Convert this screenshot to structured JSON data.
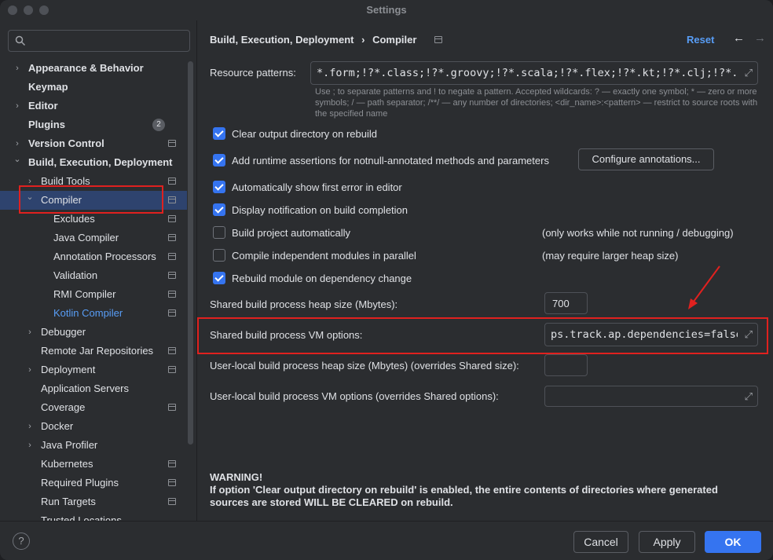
{
  "window": {
    "title": "Settings"
  },
  "search": {
    "placeholder": "",
    "value": ""
  },
  "sidebar": {
    "items": [
      {
        "label": "Appearance & Behavior",
        "level": 0,
        "expander": "collapsed",
        "bold": true
      },
      {
        "label": "Keymap",
        "level": 0,
        "expander": "none",
        "bold": true
      },
      {
        "label": "Editor",
        "level": 0,
        "expander": "collapsed",
        "bold": true
      },
      {
        "label": "Plugins",
        "level": 0,
        "expander": "none",
        "bold": true,
        "badge": "2"
      },
      {
        "label": "Version Control",
        "level": 0,
        "expander": "collapsed",
        "bold": true,
        "page_icon": true
      },
      {
        "label": "Build, Execution, Deployment",
        "level": 0,
        "expander": "expanded",
        "bold": true
      },
      {
        "label": "Build Tools",
        "level": 1,
        "expander": "collapsed",
        "page_icon": true
      },
      {
        "label": "Compiler",
        "level": 1,
        "expander": "expanded",
        "page_icon": true,
        "selected": true
      },
      {
        "label": "Excludes",
        "level": 2,
        "expander": "none",
        "page_icon": true
      },
      {
        "label": "Java Compiler",
        "level": 2,
        "expander": "none",
        "page_icon": true
      },
      {
        "label": "Annotation Processors",
        "level": 2,
        "expander": "none",
        "page_icon": true
      },
      {
        "label": "Validation",
        "level": 2,
        "expander": "none",
        "page_icon": true
      },
      {
        "label": "RMI Compiler",
        "level": 2,
        "expander": "none",
        "page_icon": true
      },
      {
        "label": "Kotlin Compiler",
        "level": 2,
        "expander": "none",
        "page_icon": true,
        "link": true
      },
      {
        "label": "Debugger",
        "level": 1,
        "expander": "collapsed"
      },
      {
        "label": "Remote Jar Repositories",
        "level": 1,
        "expander": "none",
        "page_icon": true
      },
      {
        "label": "Deployment",
        "level": 1,
        "expander": "collapsed",
        "page_icon": true
      },
      {
        "label": "Application Servers",
        "level": 1,
        "expander": "none"
      },
      {
        "label": "Coverage",
        "level": 1,
        "expander": "none",
        "page_icon": true
      },
      {
        "label": "Docker",
        "level": 1,
        "expander": "collapsed"
      },
      {
        "label": "Java Profiler",
        "level": 1,
        "expander": "collapsed"
      },
      {
        "label": "Kubernetes",
        "level": 1,
        "expander": "none",
        "page_icon": true
      },
      {
        "label": "Required Plugins",
        "level": 1,
        "expander": "none",
        "page_icon": true
      },
      {
        "label": "Run Targets",
        "level": 1,
        "expander": "none",
        "page_icon": true
      },
      {
        "label": "Trusted Locations",
        "level": 1,
        "expander": "none"
      }
    ]
  },
  "header": {
    "breadcrumb_parent": "Build, Execution, Deployment",
    "breadcrumb_sep": "›",
    "breadcrumb_current": "Compiler",
    "reset_label": "Reset",
    "back_icon": "←",
    "forward_icon": "→"
  },
  "resource_patterns": {
    "label": "Resource patterns:",
    "value": "*.form;!?*.class;!?*.groovy;!?*.scala;!?*.flex;!?*.kt;!?*.clj;!?*.aj",
    "hint": "Use ; to separate patterns and ! to negate a pattern. Accepted wildcards: ? — exactly one symbol; * — zero or more symbols; / — path separator; /**/ — any number of directories; <dir_name>:<pattern> — restrict to source roots with the specified name"
  },
  "options": [
    {
      "label": "Clear output directory on rebuild",
      "checked": true,
      "note": ""
    },
    {
      "label": "Add runtime assertions for notnull-annotated methods and parameters",
      "checked": true,
      "note": ""
    },
    {
      "label": "Automatically show first error in editor",
      "checked": true,
      "note": ""
    },
    {
      "label": "Display notification on build completion",
      "checked": true,
      "note": ""
    },
    {
      "label": "Build project automatically",
      "checked": false,
      "note": "(only works while not running / debugging)"
    },
    {
      "label": "Compile independent modules in parallel",
      "checked": false,
      "note": "(may require larger heap size)"
    },
    {
      "label": "Rebuild module on dependency change",
      "checked": true,
      "note": ""
    }
  ],
  "configure_annotations_label": "Configure annotations...",
  "shared_heap": {
    "label": "Shared build process heap size (Mbytes):",
    "value": "700"
  },
  "shared_vm": {
    "label": "Shared build process VM options:",
    "value": "ps.track.ap.dependencies=false"
  },
  "user_heap": {
    "label": "User-local build process heap size (Mbytes) (overrides Shared size):",
    "value": ""
  },
  "user_vm": {
    "label": "User-local build process VM options (overrides Shared options):",
    "value": ""
  },
  "warning": {
    "title": "WARNING!",
    "text": "If option 'Clear output directory on rebuild' is enabled, the entire contents of directories where generated sources are stored WILL BE CLEARED on rebuild."
  },
  "footer": {
    "help": "?",
    "cancel": "Cancel",
    "apply": "Apply",
    "ok": "OK"
  },
  "colors": {
    "accent": "#3574f0",
    "link": "#589df6",
    "annotation_red": "#e0211f",
    "selected_row": "#2e436e"
  }
}
